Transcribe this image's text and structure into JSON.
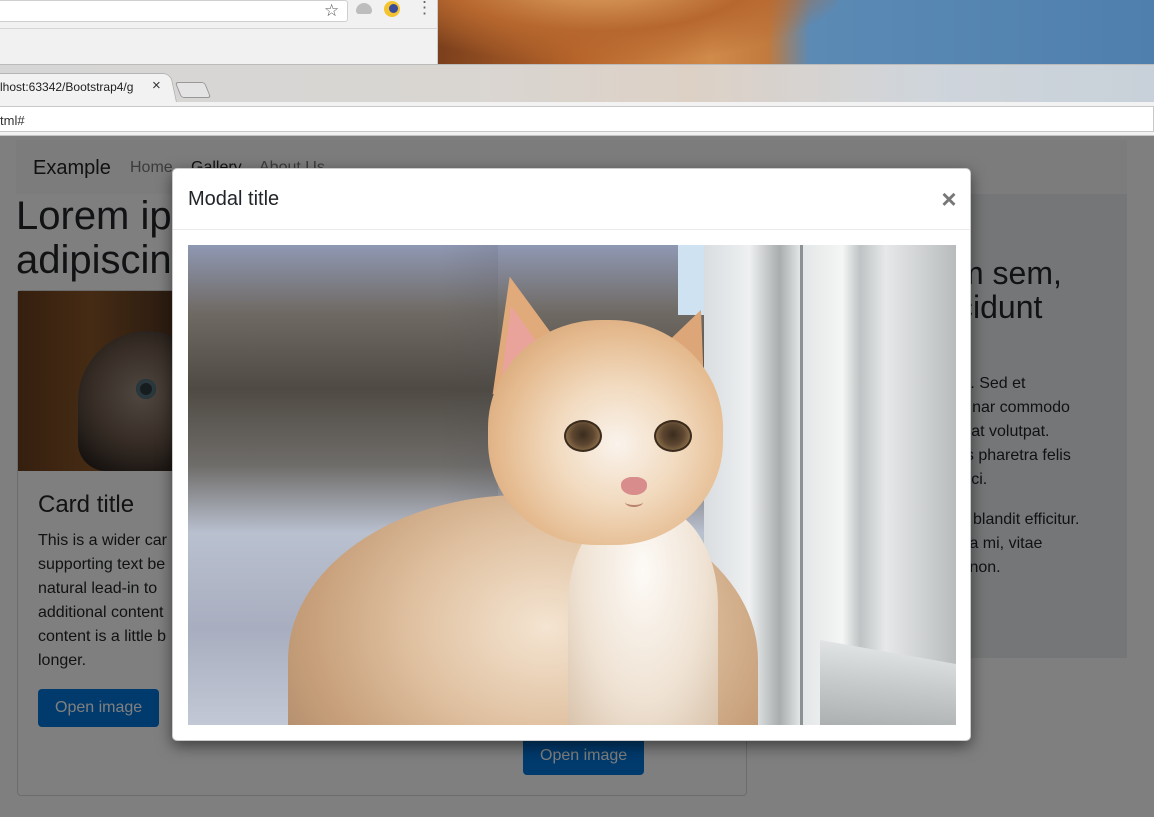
{
  "browser": {
    "active_tab_title": "lhost:63342/Bootstrap4/g",
    "tab_close_icon": "×",
    "address": "tml#",
    "bookmark_icon": "☆",
    "menu_icon": "⋮"
  },
  "page": {
    "navbar": {
      "brand": "Example",
      "links": [
        "Home",
        "Gallery",
        "About Us"
      ]
    },
    "hero_heading": [
      "Lorem ips",
      "adipiscin"
    ],
    "card_1": {
      "title": "Card title",
      "text": [
        "This is a wider car",
        "supporting text be",
        "natural lead-in to",
        "additional content",
        "content is a little b",
        "longer."
      ],
      "button": "Open image"
    },
    "card_3": {
      "button": "Open image"
    },
    "side": {
      "heading": [
        "m sem,",
        "cidunt"
      ],
      "para_1": [
        "m. Sed et",
        "lvinar commodo",
        "erat volutpat.",
        "us pharetra felis",
        "orci."
      ],
      "para_2": [
        "is blandit efficitur.",
        "ida mi, vitae",
        "s non."
      ]
    }
  },
  "modal": {
    "title": "Modal title",
    "close_icon": "×"
  }
}
